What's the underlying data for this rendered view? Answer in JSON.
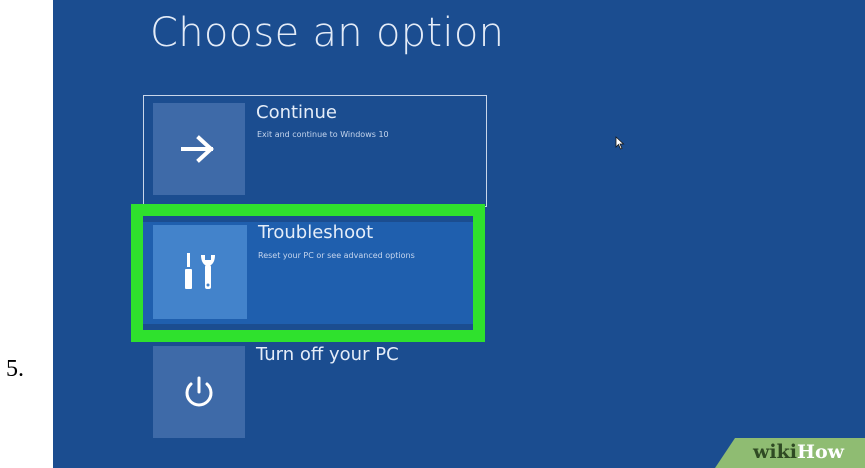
{
  "step": {
    "number": "5."
  },
  "screen": {
    "title": "Choose an option",
    "options": [
      {
        "title": "Continue",
        "description": "Exit and continue to Windows 10",
        "icon": "arrow-right-icon"
      },
      {
        "title": "Troubleshoot",
        "description": "Reset your PC or see advanced options",
        "icon": "tools-icon",
        "highlighted": true
      },
      {
        "title": "Turn off your PC",
        "description": "",
        "icon": "power-icon"
      }
    ]
  },
  "watermark": {
    "part1": "wiki",
    "part2": "How"
  },
  "colors": {
    "background": "#1b4d90",
    "tile": "#3e6aa8",
    "selected_row": "#1f5fae",
    "selected_tile": "#4383cb",
    "highlight_border": "#2fe12d",
    "watermark_bg": "#8fbc72"
  }
}
